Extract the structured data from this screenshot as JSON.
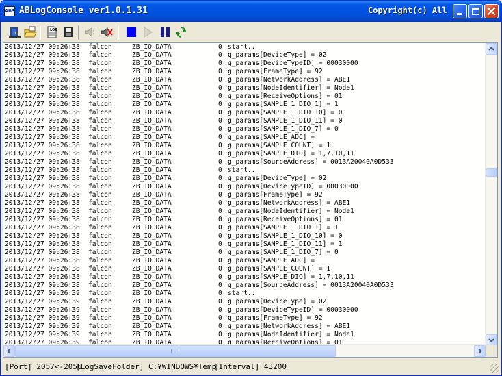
{
  "window": {
    "app_icon_text": "ABS",
    "title": "ABLogConsole ver1.0.1.31",
    "copyright": "Copyright(c) All ..."
  },
  "toolbar": {
    "buttons": [
      "exit-icon",
      "open-folder-icon",
      "log-icon",
      "save-icon",
      "sound-on-icon",
      "sound-mute-icon",
      "stop-icon",
      "play-icon",
      "pause-icon",
      "refresh-icon"
    ]
  },
  "log": {
    "lines": [
      {
        "ts": "2013/12/27 09:26:38",
        "host": "falcon",
        "cat": "ZB_IO_DATA",
        "lvl": "0",
        "msg": "start.."
      },
      {
        "ts": "2013/12/27 09:26:38",
        "host": "falcon",
        "cat": "ZB_IO_DATA",
        "lvl": "0",
        "msg": "g_params[DeviceType] = 02"
      },
      {
        "ts": "2013/12/27 09:26:38",
        "host": "falcon",
        "cat": "ZB_IO_DATA",
        "lvl": "0",
        "msg": "g_params[DeviceTypeID] = 00030000"
      },
      {
        "ts": "2013/12/27 09:26:38",
        "host": "falcon",
        "cat": "ZB_IO_DATA",
        "lvl": "0",
        "msg": "g_params[FrameType] = 92"
      },
      {
        "ts": "2013/12/27 09:26:38",
        "host": "falcon",
        "cat": "ZB_IO_DATA",
        "lvl": "0",
        "msg": "g_params[NetworkAddress] = ABE1"
      },
      {
        "ts": "2013/12/27 09:26:38",
        "host": "falcon",
        "cat": "ZB_IO_DATA",
        "lvl": "0",
        "msg": "g_params[NodeIdentifier] = Node1"
      },
      {
        "ts": "2013/12/27 09:26:38",
        "host": "falcon",
        "cat": "ZB_IO_DATA",
        "lvl": "0",
        "msg": "g_params[ReceiveOptions] = 01"
      },
      {
        "ts": "2013/12/27 09:26:38",
        "host": "falcon",
        "cat": "ZB_IO_DATA",
        "lvl": "0",
        "msg": "g_params[SAMPLE_1_DIO_1] = 1"
      },
      {
        "ts": "2013/12/27 09:26:38",
        "host": "falcon",
        "cat": "ZB_IO_DATA",
        "lvl": "0",
        "msg": "g_params[SAMPLE_1_DIO_10] = 0"
      },
      {
        "ts": "2013/12/27 09:26:38",
        "host": "falcon",
        "cat": "ZB_IO_DATA",
        "lvl": "0",
        "msg": "g_params[SAMPLE_1_DIO_11] = 0"
      },
      {
        "ts": "2013/12/27 09:26:38",
        "host": "falcon",
        "cat": "ZB_IO_DATA",
        "lvl": "0",
        "msg": "g_params[SAMPLE_1_DIO_7] = 0"
      },
      {
        "ts": "2013/12/27 09:26:38",
        "host": "falcon",
        "cat": "ZB_IO_DATA",
        "lvl": "0",
        "msg": "g_params[SAMPLE_ADC] ="
      },
      {
        "ts": "2013/12/27 09:26:38",
        "host": "falcon",
        "cat": "ZB_IO_DATA",
        "lvl": "0",
        "msg": "g_params[SAMPLE_COUNT] = 1"
      },
      {
        "ts": "2013/12/27 09:26:38",
        "host": "falcon",
        "cat": "ZB_IO_DATA",
        "lvl": "0",
        "msg": "g_params[SAMPLE_DIO] = 1,7,10,11"
      },
      {
        "ts": "2013/12/27 09:26:38",
        "host": "falcon",
        "cat": "ZB_IO_DATA",
        "lvl": "0",
        "msg": "g_params[SourceAddress] = 0013A20040A0D533"
      },
      {
        "ts": "2013/12/27 09:26:38",
        "host": "falcon",
        "cat": "ZB_IO_DATA",
        "lvl": "0",
        "msg": "start.."
      },
      {
        "ts": "2013/12/27 09:26:38",
        "host": "falcon",
        "cat": "ZB_IO_DATA",
        "lvl": "0",
        "msg": "g_params[DeviceType] = 02"
      },
      {
        "ts": "2013/12/27 09:26:38",
        "host": "falcon",
        "cat": "ZB_IO_DATA",
        "lvl": "0",
        "msg": "g_params[DeviceTypeID] = 00030000"
      },
      {
        "ts": "2013/12/27 09:26:38",
        "host": "falcon",
        "cat": "ZB_IO_DATA",
        "lvl": "0",
        "msg": "g_params[FrameType] = 92"
      },
      {
        "ts": "2013/12/27 09:26:38",
        "host": "falcon",
        "cat": "ZB_IO_DATA",
        "lvl": "0",
        "msg": "g_params[NetworkAddress] = ABE1"
      },
      {
        "ts": "2013/12/27 09:26:38",
        "host": "falcon",
        "cat": "ZB_IO_DATA",
        "lvl": "0",
        "msg": "g_params[NodeIdentifier] = Node1"
      },
      {
        "ts": "2013/12/27 09:26:38",
        "host": "falcon",
        "cat": "ZB_IO_DATA",
        "lvl": "0",
        "msg": "g_params[ReceiveOptions] = 01"
      },
      {
        "ts": "2013/12/27 09:26:38",
        "host": "falcon",
        "cat": "ZB_IO_DATA",
        "lvl": "0",
        "msg": "g_params[SAMPLE_1_DIO_1] = 1"
      },
      {
        "ts": "2013/12/27 09:26:38",
        "host": "falcon",
        "cat": "ZB_IO_DATA",
        "lvl": "0",
        "msg": "g_params[SAMPLE_1_DIO_10] = 0"
      },
      {
        "ts": "2013/12/27 09:26:38",
        "host": "falcon",
        "cat": "ZB_IO_DATA",
        "lvl": "0",
        "msg": "g_params[SAMPLE_1_DIO_11] = 1"
      },
      {
        "ts": "2013/12/27 09:26:38",
        "host": "falcon",
        "cat": "ZB_IO_DATA",
        "lvl": "0",
        "msg": "g_params[SAMPLE_1_DIO_7] = 0"
      },
      {
        "ts": "2013/12/27 09:26:38",
        "host": "falcon",
        "cat": "ZB_IO_DATA",
        "lvl": "0",
        "msg": "g_params[SAMPLE_ADC] ="
      },
      {
        "ts": "2013/12/27 09:26:38",
        "host": "falcon",
        "cat": "ZB_IO_DATA",
        "lvl": "0",
        "msg": "g_params[SAMPLE_COUNT] = 1"
      },
      {
        "ts": "2013/12/27 09:26:38",
        "host": "falcon",
        "cat": "ZB_IO_DATA",
        "lvl": "0",
        "msg": "g_params[SAMPLE_DIO] = 1,7,10,11"
      },
      {
        "ts": "2013/12/27 09:26:38",
        "host": "falcon",
        "cat": "ZB_IO_DATA",
        "lvl": "0",
        "msg": "g_params[SourceAddress] = 0013A20040A0D533"
      },
      {
        "ts": "2013/12/27 09:26:39",
        "host": "falcon",
        "cat": "ZB_IO_DATA",
        "lvl": "0",
        "msg": "start.."
      },
      {
        "ts": "2013/12/27 09:26:39",
        "host": "falcon",
        "cat": "ZB_IO_DATA",
        "lvl": "0",
        "msg": "g_params[DeviceType] = 02"
      },
      {
        "ts": "2013/12/27 09:26:39",
        "host": "falcon",
        "cat": "ZB_IO_DATA",
        "lvl": "0",
        "msg": "g_params[DeviceTypeID] = 00030000"
      },
      {
        "ts": "2013/12/27 09:26:39",
        "host": "falcon",
        "cat": "ZB_IO_DATA",
        "lvl": "0",
        "msg": "g_params[FrameType] = 92"
      },
      {
        "ts": "2013/12/27 09:26:39",
        "host": "falcon",
        "cat": "ZB_IO_DATA",
        "lvl": "0",
        "msg": "g_params[NetworkAddress] = ABE1"
      },
      {
        "ts": "2013/12/27 09:26:39",
        "host": "falcon",
        "cat": "ZB_IO_DATA",
        "lvl": "0",
        "msg": "g_params[NodeIdentifier] = Node1"
      },
      {
        "ts": "2013/12/27 09:26:39",
        "host": "falcon",
        "cat": "ZB_IO_DATA",
        "lvl": "0",
        "msg": "g_params[ReceiveOptions] = 01"
      }
    ]
  },
  "status": {
    "port": "[Port] 2057<-2056",
    "folder": "[LogSaveFolder] C:¥WINDOWS¥Temp",
    "interval": "[Interval] 43200"
  },
  "scroll": {
    "vertical_position": 0.42
  }
}
